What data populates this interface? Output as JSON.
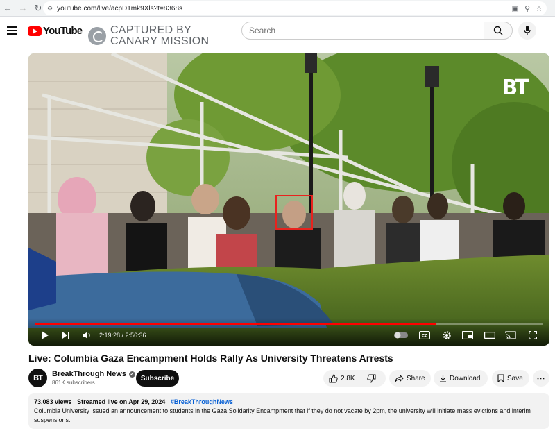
{
  "browser": {
    "url": "youtube.com/live/acpD1mk9Xls?t=8368s"
  },
  "header": {
    "logo_text": "YouTube",
    "watermark_line1": "CAPTURED BY",
    "watermark_line2": "CANARY MISSION",
    "search_placeholder": "Search"
  },
  "video": {
    "badge": "BT",
    "current_time": "2:19:28",
    "duration": "2:56:36",
    "time_display": "2:19:28 / 2:56:36",
    "progress_fraction": 0.789,
    "highlight_color": "#e8231e",
    "progress_color": "#ff0000"
  },
  "meta": {
    "title": "Live: Columbia Gaza Encampment Holds Rally As University Threatens Arrests",
    "channel_initials": "BT",
    "channel_name": "BreakThrough News",
    "subscribers": "861K subscribers",
    "subscribe_label": "Subscribe",
    "likes": "2.8K",
    "share_label": "Share",
    "download_label": "Download",
    "save_label": "Save"
  },
  "description": {
    "views": "73,083 views",
    "streamed": "Streamed live on Apr 29, 2024",
    "hashtag": "#BreakThroughNews",
    "text": "Columbia University issued an announcement to students in the Gaza Solidarity Encampment that if they do not vacate by 2pm, the university will initiate mass evictions and interim suspensions."
  }
}
